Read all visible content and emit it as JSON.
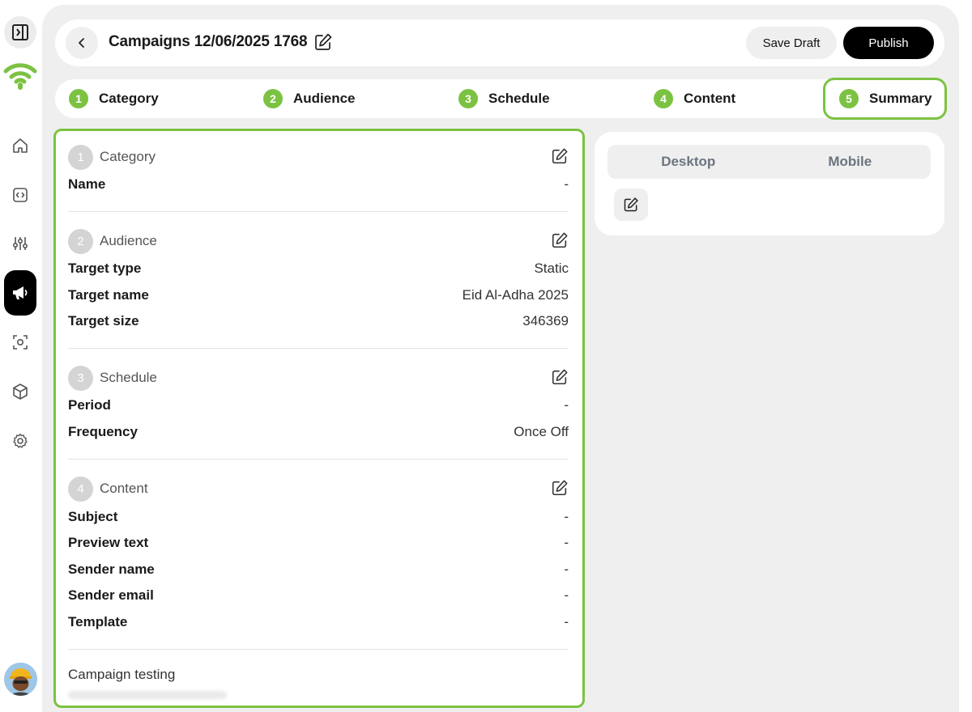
{
  "app": {
    "logo_icon": "wifi-logo-icon",
    "brand_color": "#7cc242"
  },
  "rail": {
    "toggle_icon": "sidebar-toggle-icon",
    "items": [
      {
        "icon": "home-icon",
        "active": false
      },
      {
        "icon": "code-icon",
        "active": false
      },
      {
        "icon": "sliders-icon",
        "active": false
      },
      {
        "icon": "megaphone-icon",
        "active": true
      },
      {
        "icon": "scan-icon",
        "active": false
      },
      {
        "icon": "cube-icon",
        "active": false
      },
      {
        "icon": "gear-icon",
        "active": false
      }
    ],
    "avatar_icon": "user-avatar"
  },
  "header": {
    "title": "Campaigns 12/06/2025 1768",
    "save_draft_label": "Save Draft",
    "publish_label": "Publish"
  },
  "stepper": {
    "steps": [
      {
        "num": "1",
        "label": "Category"
      },
      {
        "num": "2",
        "label": "Audience"
      },
      {
        "num": "3",
        "label": "Schedule"
      },
      {
        "num": "4",
        "label": "Content"
      },
      {
        "num": "5",
        "label": "Summary"
      }
    ],
    "current": "5"
  },
  "summary": {
    "category": {
      "num": "1",
      "title": "Category",
      "rows": [
        {
          "key": "Name",
          "value": "-"
        }
      ]
    },
    "audience": {
      "num": "2",
      "title": "Audience",
      "rows": [
        {
          "key": "Target type",
          "value": "Static"
        },
        {
          "key": "Target name",
          "value": "Eid Al-Adha 2025"
        },
        {
          "key": "Target size",
          "value": "346369"
        }
      ]
    },
    "schedule": {
      "num": "3",
      "title": "Schedule",
      "rows": [
        {
          "key": "Period",
          "value": "-"
        },
        {
          "key": "Frequency",
          "value": "Once Off"
        }
      ]
    },
    "content": {
      "num": "4",
      "title": "Content",
      "rows": [
        {
          "key": "Subject",
          "value": "-"
        },
        {
          "key": "Preview text",
          "value": "-"
        },
        {
          "key": "Sender name",
          "value": "-"
        },
        {
          "key": "Sender email",
          "value": "-"
        },
        {
          "key": "Template",
          "value": "-"
        }
      ]
    },
    "testing_title": "Campaign testing"
  },
  "preview": {
    "tabs": [
      {
        "label": "Desktop"
      },
      {
        "label": "Mobile"
      }
    ]
  }
}
